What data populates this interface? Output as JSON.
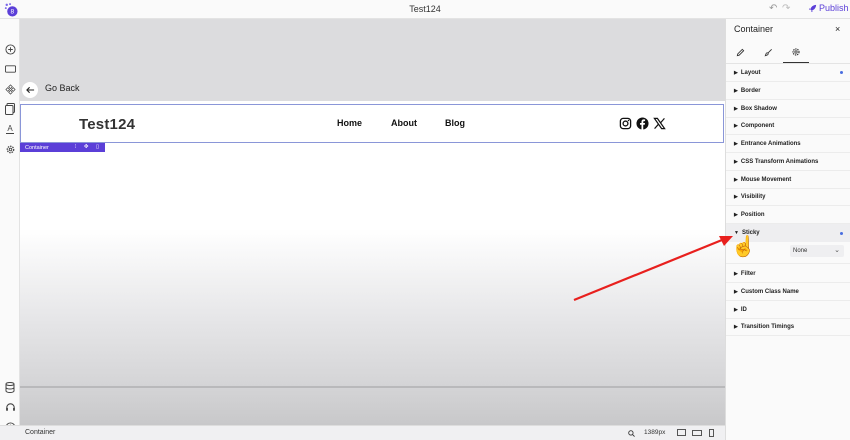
{
  "topbar": {
    "title": "Test124",
    "publish_label": "Publish",
    "undo_icon": "↶",
    "redo_icon": "↷"
  },
  "canvas": {
    "back_label": "Go Back",
    "site_title": "Test124",
    "nav": [
      "Home",
      "About",
      "Blog"
    ],
    "social_icons": [
      "instagram-icon",
      "facebook-icon",
      "x-icon"
    ],
    "selected_tag": "Container"
  },
  "statusbar": {
    "element_label": "Container",
    "zoom": "1389px"
  },
  "panel": {
    "title": "Container",
    "close_icon": "×",
    "tabs": [
      "pencil-icon",
      "brush-icon",
      "gear-icon"
    ],
    "sections": [
      {
        "label": "Layout",
        "modified": true
      },
      {
        "label": "Border",
        "modified": false
      },
      {
        "label": "Box Shadow",
        "modified": false
      },
      {
        "label": "Component",
        "modified": false
      },
      {
        "label": "Entrance Animations",
        "modified": false
      },
      {
        "label": "CSS Transform Animations",
        "modified": false
      },
      {
        "label": "Mouse Movement",
        "modified": false
      },
      {
        "label": "Visibility",
        "modified": false
      },
      {
        "label": "Position",
        "modified": false
      },
      {
        "label": "Sticky",
        "modified": true,
        "expanded": true
      },
      {
        "label": "Filter",
        "modified": false
      },
      {
        "label": "Custom Class Name",
        "modified": false
      },
      {
        "label": "ID",
        "modified": false
      },
      {
        "label": "Transition Timings",
        "modified": false
      }
    ],
    "sticky_select_value": "None"
  },
  "colors": {
    "accent": "#5b3fd8",
    "modified_dot": "#4a6ee0",
    "annotation_arrow": "#e8201e"
  }
}
